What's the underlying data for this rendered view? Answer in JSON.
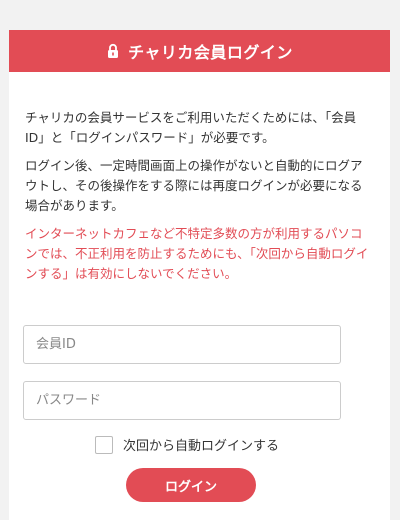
{
  "header": {
    "icon": "lock-icon",
    "title": "チャリカ会員ログイン",
    "color": "#e24c55"
  },
  "intro": {
    "para1": "チャリカの会員サービスをご利用いただくためには、「会員ID」と「ログインパスワード」が必要です。",
    "para2": "ログイン後、一定時間画面上の操作がないと自動的にログアウトし、その後操作をする際には再度ログインが必要になる場合があります。",
    "warning": "インターネットカフェなど不特定多数の方が利用するパソコンでは、不正利用を防止するためにも、「次回から自動ログインする」は有効にしないでください。"
  },
  "form": {
    "member_id_placeholder": "会員ID",
    "member_id_value": "",
    "password_placeholder": "パスワード",
    "password_value": "",
    "remember_label": "次回から自動ログインする",
    "remember_checked": false,
    "login_label": "ログイン"
  }
}
